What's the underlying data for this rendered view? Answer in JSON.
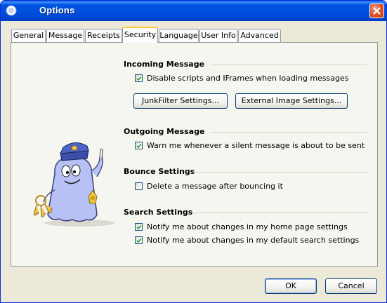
{
  "window": {
    "title": "Options",
    "close_icon": "close-icon"
  },
  "tabs": [
    {
      "label": "General",
      "active": false
    },
    {
      "label": "Message",
      "active": false
    },
    {
      "label": "Receipts",
      "active": false
    },
    {
      "label": "Security",
      "active": true
    },
    {
      "label": "Language",
      "active": false
    },
    {
      "label": "User Info",
      "active": false
    },
    {
      "label": "Advanced",
      "active": false
    }
  ],
  "security": {
    "incoming": {
      "title": "Incoming Message",
      "disable_scripts": {
        "label": "Disable scripts and IFrames when loading messages",
        "checked": true
      },
      "junkfilter_button": "JunkFilter Settings...",
      "external_image_button": "External Image Settings..."
    },
    "outgoing": {
      "title": "Outgoing Message",
      "warn_silent": {
        "label": "Warn me whenever a silent message is about to be sent",
        "checked": true
      }
    },
    "bounce": {
      "title": "Bounce Settings",
      "delete_after_bounce": {
        "label": "Delete a message after bouncing it",
        "checked": false
      }
    },
    "search": {
      "title": "Search Settings",
      "notify_home": {
        "label": "Notify me about changes in my home page settings",
        "checked": true
      },
      "notify_search": {
        "label": "Notify me about changes in my default search settings",
        "checked": true
      }
    }
  },
  "footer": {
    "ok_label": "OK",
    "cancel_label": "Cancel"
  },
  "colors": {
    "titlebar": "#0054e3",
    "dialog_bg": "#ece9d8",
    "panel_bg": "#f6f6f1",
    "tab_highlight": "#ffc83c",
    "mascot_body": "#b7c1f5"
  }
}
